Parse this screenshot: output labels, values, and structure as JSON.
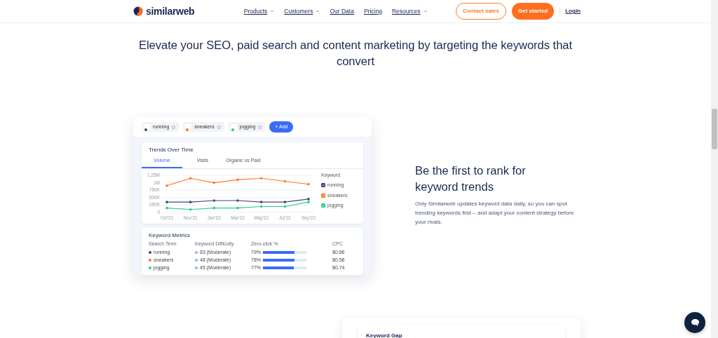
{
  "nav": {
    "brand": "similarweb",
    "items": [
      {
        "label": "Products",
        "dropdown": true
      },
      {
        "label": "Customers",
        "dropdown": true
      },
      {
        "label": "Our Data",
        "dropdown": false
      },
      {
        "label": "Pricing",
        "dropdown": false
      },
      {
        "label": "Resources",
        "dropdown": true
      }
    ],
    "contact": "Contact sales",
    "start": "Get started",
    "login": "Login"
  },
  "headline": "Elevate your SEO, paid search and content marketing by targeting the keywords that convert",
  "mockup": {
    "chips": [
      {
        "label": "running",
        "color": "#3d4b7c"
      },
      {
        "label": "sneakers",
        "color": "#ff7a29"
      },
      {
        "label": "jogging",
        "color": "#2ecc8a"
      }
    ],
    "add": "+ Add",
    "trends": {
      "title": "Trends Over Time",
      "tabs": [
        {
          "label": "Volume",
          "selected": true
        },
        {
          "label": "Visits",
          "selected": false
        },
        {
          "label": "Organic vs Paid",
          "selected": false
        }
      ],
      "legend_title": "Keyword",
      "legend": [
        {
          "checked": true
        },
        {
          "checked": true
        },
        {
          "checked": true
        }
      ],
      "chart_data": {
        "type": "line",
        "grid": true,
        "categories": [
          "Oct'21",
          "Nov'21",
          "Jan'22",
          "Mar'22",
          "May'22",
          "Jul'22",
          "Sep'22"
        ],
        "yticks": [
          {
            "value": 0,
            "label": "0"
          },
          {
            "value": 250000,
            "label": "250K"
          },
          {
            "value": 500000,
            "label": "500K"
          },
          {
            "value": 750000,
            "label": "750K"
          },
          {
            "value": 1000000,
            "label": "1M"
          },
          {
            "value": 1250000,
            "label": "1.25M"
          }
        ],
        "ylim": [
          0,
          1250000
        ],
        "series": [
          {
            "name": "running",
            "color": "#3d4b7c",
            "values": [
              350000,
              350000,
              400000,
              400000,
              350000,
              350000,
              450000
            ]
          },
          {
            "name": "sneakers",
            "color": "#ff7a29",
            "values": [
              900000,
              1150000,
              1000000,
              1100000,
              1150000,
              1050000,
              950000
            ]
          },
          {
            "name": "jogging",
            "color": "#2ecc8a",
            "values": [
              150000,
              100000,
              150000,
              150000,
              200000,
              200000,
              350000
            ]
          }
        ]
      }
    },
    "metrics": {
      "title": "Keyword Metrics",
      "columns": [
        "Search Term",
        "Keyword Difficulty",
        "Zero-click %",
        "CPC"
      ],
      "rows": [
        {
          "term": "running",
          "color": "#3d4b7c",
          "difficulty": "63 (Moderate)",
          "zero_click": "79%",
          "level": 0.73,
          "cpc": "$0.86"
        },
        {
          "term": "sneakers",
          "color": "#ff7a29",
          "difficulty": "48 (Moderate)",
          "zero_click": "78%",
          "level": 0.72,
          "cpc": "$0.58"
        },
        {
          "term": "jogging",
          "color": "#2ecc8a",
          "difficulty": "45 (Moderate)",
          "zero_click": "77%",
          "level": 0.71,
          "cpc": "$0.74"
        }
      ]
    }
  },
  "feature": {
    "title": "Be the first to rank for keyword trends",
    "text": "Only Similarweb updates keyword data daily, so you can spot trending keywords first – and adapt your content strategy before your rivals."
  },
  "next_card": {
    "title": "Keyword Gap"
  }
}
